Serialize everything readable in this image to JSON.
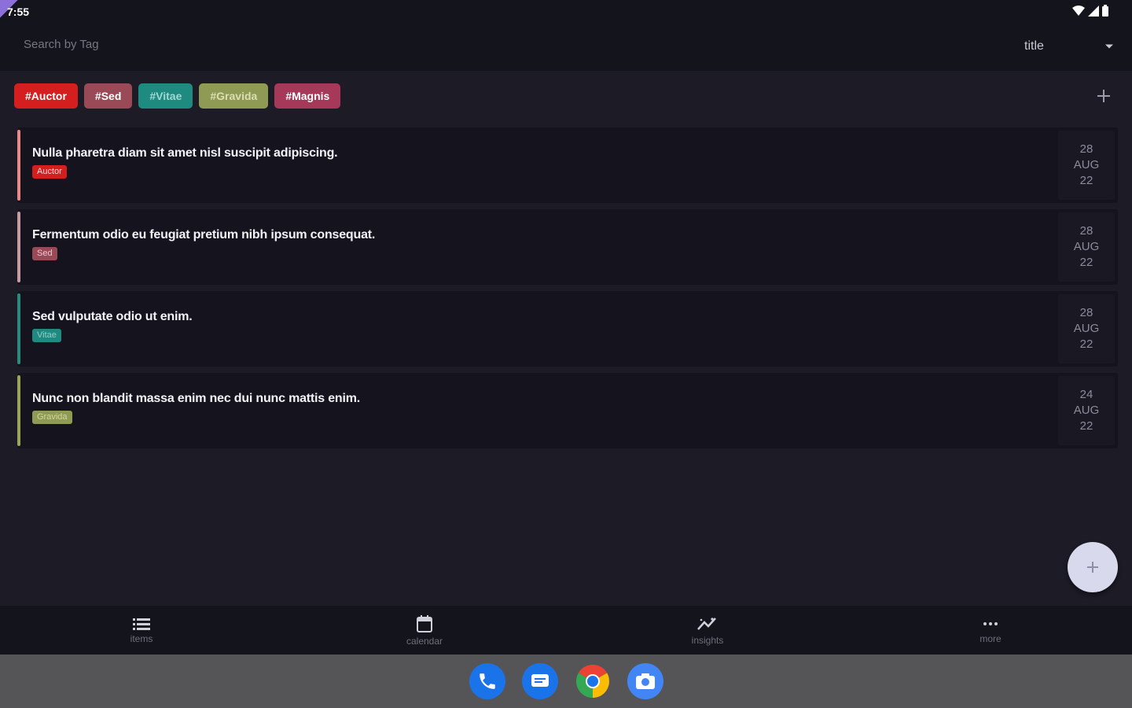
{
  "status_bar": {
    "time": "7:55"
  },
  "header": {
    "search_placeholder": "Search by Tag",
    "sort_value": "title"
  },
  "tags": [
    {
      "label": "#Auctor",
      "bg": "#d51e1e",
      "fg": "#ffffff"
    },
    {
      "label": "#Sed",
      "bg": "#9a4a57",
      "fg": "#ffffff"
    },
    {
      "label": "#Vitae",
      "bg": "#1f8a80",
      "fg": "#9fd9d2"
    },
    {
      "label": "#Gravida",
      "bg": "#8f9a55",
      "fg": "#d9dfb0"
    },
    {
      "label": "#Magnis",
      "bg": "#a6395a",
      "fg": "#ffffff"
    }
  ],
  "items": [
    {
      "title": "Nulla pharetra diam sit amet nisl suscipit adipiscing.",
      "tag": "Auctor",
      "color": "#d51e1e",
      "bar": "#e98a8a",
      "tag_fg": "#ffdada",
      "day": "28",
      "month": "AUG",
      "year": "22"
    },
    {
      "title": "Fermentum odio eu feugiat pretium nibh ipsum consequat.",
      "tag": "Sed",
      "color": "#9a4a57",
      "bar": "#c79ba2",
      "tag_fg": "#e8c9ce",
      "day": "28",
      "month": "AUG",
      "year": "22"
    },
    {
      "title": "Sed vulputate odio ut enim.",
      "tag": "Vitae",
      "color": "#1f8a80",
      "bar": "#2c8a7a",
      "tag_fg": "#8fd0c8",
      "day": "28",
      "month": "AUG",
      "year": "22"
    },
    {
      "title": "Nunc non blandit massa enim nec dui nunc mattis enim.",
      "tag": "Gravida",
      "color": "#8f9a55",
      "bar": "#9aa45a",
      "tag_fg": "#cfd69e",
      "day": "24",
      "month": "AUG",
      "year": "22"
    }
  ],
  "nav": [
    {
      "label": "items",
      "icon": "list-icon"
    },
    {
      "label": "calendar",
      "icon": "calendar-icon"
    },
    {
      "label": "insights",
      "icon": "insights-icon"
    },
    {
      "label": "more",
      "icon": "more-icon"
    }
  ],
  "dock": [
    {
      "name": "phone-app",
      "icon": "phone-icon"
    },
    {
      "name": "messages-app",
      "icon": "messages-icon"
    },
    {
      "name": "chrome-app",
      "icon": "chrome-icon"
    },
    {
      "name": "camera-app",
      "icon": "camera-icon"
    }
  ]
}
